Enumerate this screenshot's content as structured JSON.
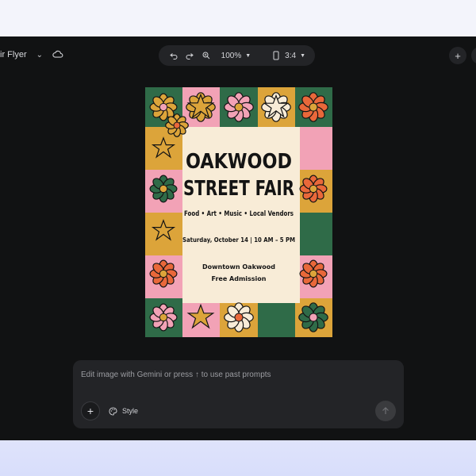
{
  "document": {
    "title": "ir Flyer"
  },
  "toolbar": {
    "zoom": "100%",
    "aspect_ratio": "3:4"
  },
  "flyer": {
    "title_line1": "OAKWOOD",
    "title_line2": "STREET FAIR",
    "tagline": "Food • Art • Music • Local Vendors",
    "date_time": "Saturday, October 14 | 10 AM – 5 PM",
    "location": "Downtown Oakwood",
    "admission": "Free Admission",
    "colors": {
      "green": "#2f6b48",
      "pink": "#f2a2b6",
      "mustard": "#dca43a",
      "cream": "#f8ecd7",
      "orange": "#e9683a",
      "ink": "#141414"
    }
  },
  "prompt": {
    "placeholder": "Edit image with Gemini or press ↑ to use past prompts",
    "style_label": "Style"
  },
  "icons": [
    "chevron-down-icon",
    "cloud-icon",
    "undo-icon",
    "redo-icon",
    "zoom-icon",
    "phone-icon",
    "plus-icon",
    "palette-icon",
    "send-arrow-icon"
  ]
}
